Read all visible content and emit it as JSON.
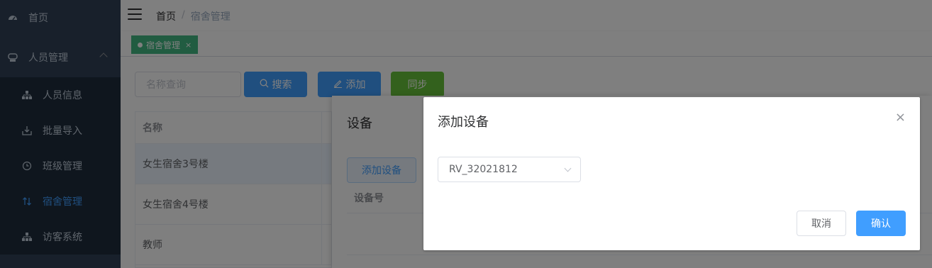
{
  "sidebar": {
    "items": [
      {
        "label": "首页",
        "icon": "dashboard-icon"
      },
      {
        "label": "人员管理",
        "icon": "peoples-icon"
      },
      {
        "label": "人员信息",
        "icon": "tree-icon"
      },
      {
        "label": "批量导入",
        "icon": "download-icon"
      },
      {
        "label": "班级管理",
        "icon": "clock-icon"
      },
      {
        "label": "宿舍管理",
        "icon": "sort-icon"
      },
      {
        "label": "访客系统",
        "icon": "tree-icon"
      }
    ]
  },
  "navbar": {
    "breadcrumb": {
      "home": "首页",
      "separator": "/",
      "current": "宿舍管理"
    }
  },
  "tags": [
    {
      "label": "宿舍管理",
      "close": "×"
    }
  ],
  "toolbar": {
    "search_placeholder": "名称查询",
    "search_label": "搜索",
    "add_label": "添加",
    "sync_label": "同步"
  },
  "table": {
    "header": "名称",
    "rows": [
      "女生宿舍3号楼",
      "女生宿舍4号楼",
      "教师"
    ]
  },
  "drawer": {
    "title": "设备",
    "add_device_label": "添加设备",
    "column_device_no": "设备号"
  },
  "dialog": {
    "title": "添加设备",
    "close": "×",
    "select_value": "RV_32021812",
    "cancel_label": "取消",
    "confirm_label": "确认"
  },
  "colors": {
    "sidebar_bg": "#304156",
    "active": "#409eff",
    "tag": "#42b983",
    "sync": "#67c23a"
  }
}
